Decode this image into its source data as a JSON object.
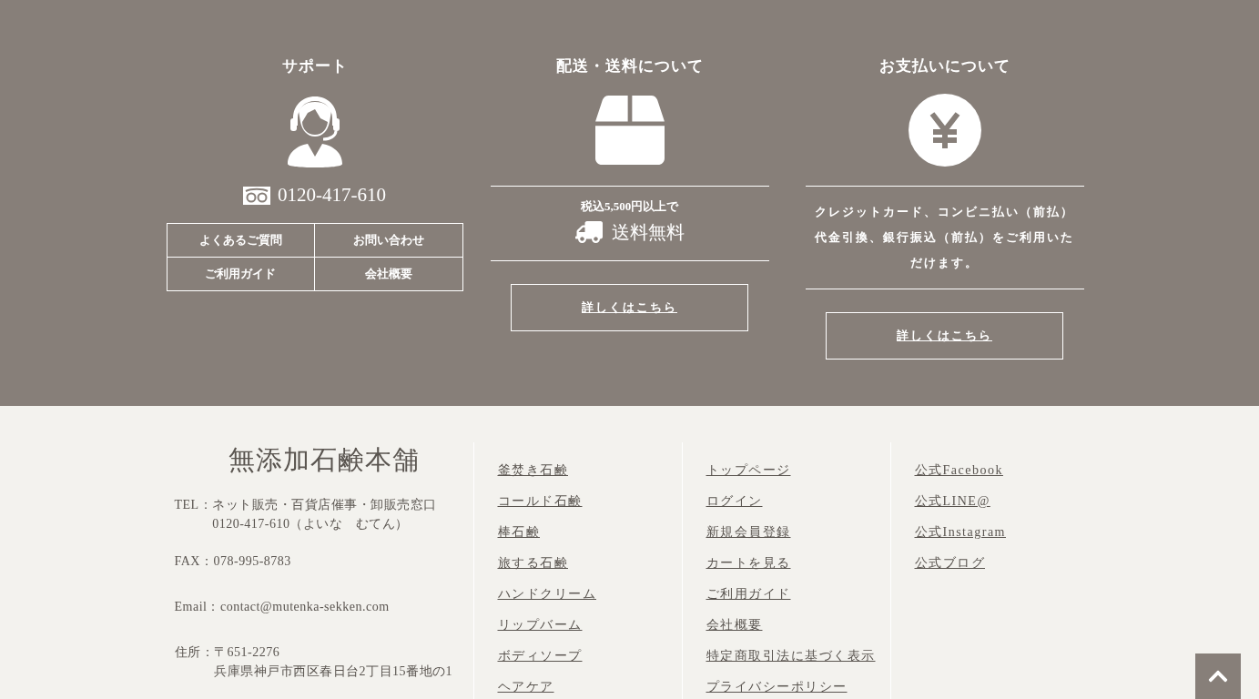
{
  "support": {
    "title": "サポート",
    "phone": "0120-417-610",
    "links": [
      "よくあるご質問",
      "お問い合わせ",
      "ご利用ガイド",
      "会社概要"
    ]
  },
  "shipping": {
    "title": "配送・送料について",
    "condition": "税込5,500円以上で",
    "free_label": "送料無料",
    "button": "詳しくはこちら"
  },
  "payment": {
    "title": "お支払いについて",
    "text": "クレジットカード、コンビニ払い（前払）代金引換、銀行振込（前払）をご利用いただけます。",
    "button": "詳しくはこちら"
  },
  "footer": {
    "brand": "無添加石鹸本舗",
    "contact": [
      {
        "label": "TEL：",
        "lines": [
          "ネット販売・百貨店催事・卸販売窓口",
          "0120-417-610（よいな　むてん）"
        ]
      },
      {
        "label": "FAX：",
        "lines": [
          "078-995-8783"
        ]
      },
      {
        "label": "Email：",
        "lines": [
          "contact@mutenka-sekken.com"
        ]
      },
      {
        "label": "住所：",
        "lines": [
          "〒651-2276",
          "兵庫県神戸市西区春日台2丁目15番地の1"
        ]
      }
    ],
    "link_columns": [
      [
        "釜焚き石鹸",
        "コールド石鹸",
        "棒石鹸",
        "旅する石鹸",
        "ハンドクリーム",
        "リップバーム",
        "ボディソープ",
        "ヘアケア"
      ],
      [
        "トップページ",
        "ログイン",
        "新規会員登録",
        "カートを見る",
        "ご利用ガイド",
        "会社概要",
        "特定商取引法に基づく表示",
        "プライバシーポリシー"
      ],
      [
        "公式Facebook",
        "公式LINE@",
        "公式Instagram",
        "公式ブログ"
      ]
    ]
  }
}
